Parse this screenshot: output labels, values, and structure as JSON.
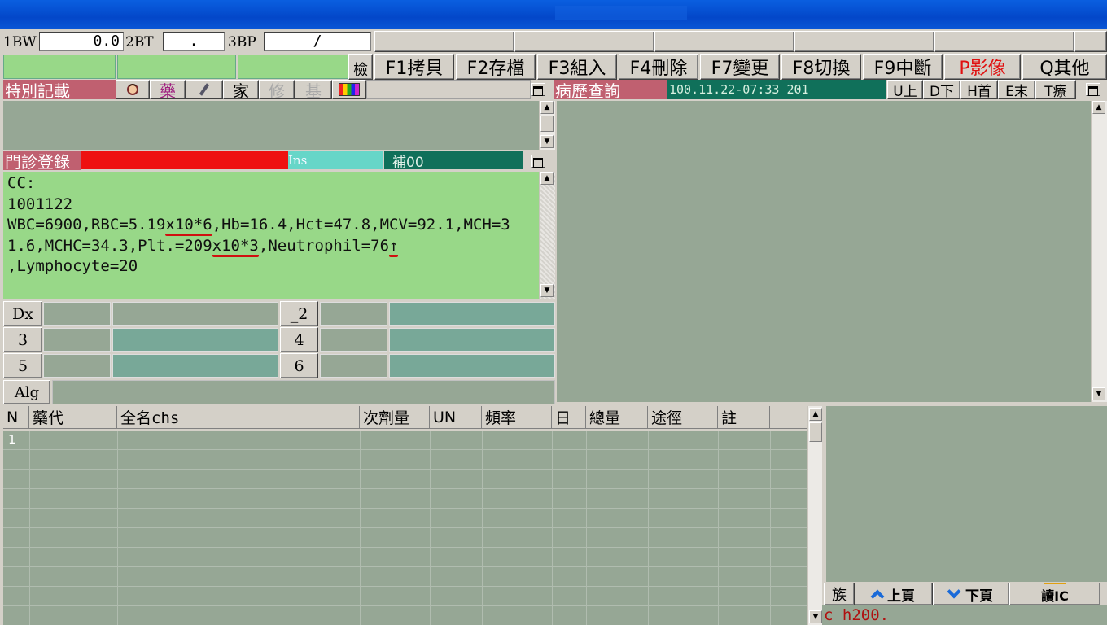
{
  "vitals": {
    "bw_label": "1BW",
    "bw_value": "0.0",
    "bt_label": "2BT",
    "bt_value": ".",
    "bp_label": "3BP",
    "bp_value": "/"
  },
  "toolbar": {
    "check_label": "檢",
    "f1": "F1拷貝",
    "f2": "F2存檔",
    "f3": "F3組入",
    "f4": "F4刪除",
    "f7": "F7變更",
    "f8": "F8切換",
    "f9": "F9中斷",
    "p_image": "P影像",
    "q_other": "Q其他"
  },
  "special_note": {
    "title": "特別記載",
    "tabs": {
      "drug": "藥",
      "family": "家",
      "repair": "修",
      "base": "基"
    }
  },
  "history": {
    "title": "病歷查詢",
    "datetime": "100.11.22-07:33 201",
    "nav": {
      "up": "U上",
      "down": "D下",
      "home": "H首",
      "end": "E末",
      "treat": "T療"
    }
  },
  "registration": {
    "title": "門診登錄",
    "ins": "Ins",
    "supplement": "補00"
  },
  "note_text": {
    "l1": "CC:",
    "l2": "1001122",
    "l3a": "WBC=6900,RBC=5.19",
    "l3b": "x10*6",
    "l3c": ",Hb=16.4,Hct=47.8,MCV=92.1,MCH=3",
    "l4a": "1.6,MCHC=34.3,Plt.=209",
    "l4b": "x10*3",
    "l4c": ",Neutrophil=76",
    "l4d": "↑",
    "l5": ",Lymphocyte=20"
  },
  "diagnosis": {
    "dx": "Dx",
    "d2": "_2",
    "d3": "3",
    "d4": "4",
    "d5": "5",
    "d6": "6",
    "alg": "Alg"
  },
  "rx_table": {
    "headers": [
      "N",
      "藥代",
      "全名chs",
      "次劑量",
      "UN",
      "頻率",
      "日",
      "總量",
      "途徑",
      "註"
    ],
    "row1_n": "1"
  },
  "right_panel": {
    "family_btn": "族",
    "prev_page": "上頁",
    "next_page": "下頁",
    "read_ic": "讀IC",
    "command": "c h200."
  },
  "colors": {
    "green": "#98d888",
    "sage": "#96a795",
    "teal": "#78a898",
    "rose": "#c06070",
    "red": "#ee1111",
    "dark_green": "#10705a",
    "ins_cyan": "#66d6c8"
  }
}
